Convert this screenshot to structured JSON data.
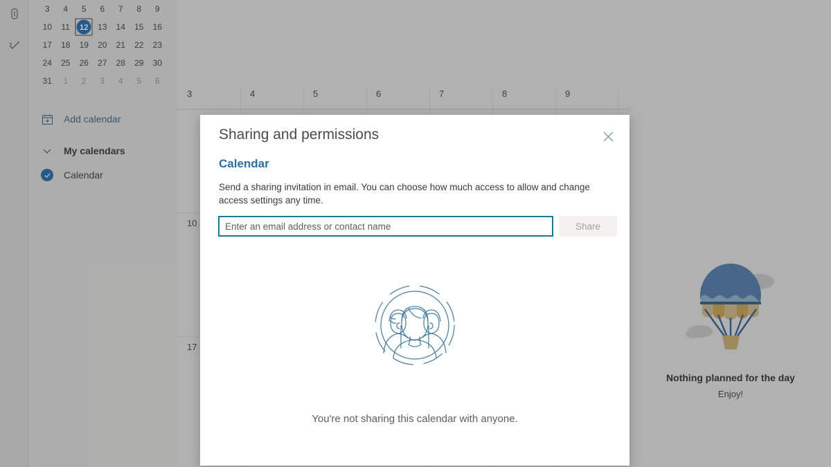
{
  "rail": {
    "items": [
      {
        "name": "calendar-rail-icon",
        "label": "Calendar"
      },
      {
        "name": "tasks-rail-icon",
        "label": "To Do"
      }
    ]
  },
  "sidebar": {
    "mini_calendar": {
      "weeks": [
        [
          {
            "day": "3",
            "state": "normal"
          },
          {
            "day": "4",
            "state": "normal"
          },
          {
            "day": "5",
            "state": "normal"
          },
          {
            "day": "6",
            "state": "normal"
          },
          {
            "day": "7",
            "state": "normal"
          },
          {
            "day": "8",
            "state": "normal"
          },
          {
            "day": "9",
            "state": "normal"
          }
        ],
        [
          {
            "day": "10",
            "state": "normal"
          },
          {
            "day": "11",
            "state": "normal"
          },
          {
            "day": "12",
            "state": "today"
          },
          {
            "day": "13",
            "state": "normal"
          },
          {
            "day": "14",
            "state": "normal"
          },
          {
            "day": "15",
            "state": "normal"
          },
          {
            "day": "16",
            "state": "normal"
          }
        ],
        [
          {
            "day": "17",
            "state": "normal"
          },
          {
            "day": "18",
            "state": "normal"
          },
          {
            "day": "19",
            "state": "normal"
          },
          {
            "day": "20",
            "state": "normal"
          },
          {
            "day": "21",
            "state": "normal"
          },
          {
            "day": "22",
            "state": "normal"
          },
          {
            "day": "23",
            "state": "normal"
          }
        ],
        [
          {
            "day": "24",
            "state": "normal"
          },
          {
            "day": "25",
            "state": "normal"
          },
          {
            "day": "26",
            "state": "normal"
          },
          {
            "day": "27",
            "state": "normal"
          },
          {
            "day": "28",
            "state": "normal"
          },
          {
            "day": "29",
            "state": "normal"
          },
          {
            "day": "30",
            "state": "normal"
          }
        ],
        [
          {
            "day": "31",
            "state": "normal"
          },
          {
            "day": "1",
            "state": "muted"
          },
          {
            "day": "2",
            "state": "muted"
          },
          {
            "day": "3",
            "state": "muted"
          },
          {
            "day": "4",
            "state": "muted"
          },
          {
            "day": "5",
            "state": "muted"
          },
          {
            "day": "6",
            "state": "muted"
          }
        ]
      ],
      "selected_day": "12"
    },
    "add_calendar_label": "Add calendar",
    "my_calendars_label": "My calendars",
    "calendar_item_label": "Calendar"
  },
  "main_calendar": {
    "day_numbers": [
      "3",
      "4",
      "5",
      "6",
      "7",
      "8",
      "9"
    ],
    "week_row_labels": [
      "10",
      "17"
    ]
  },
  "right_panel": {
    "title": "Nothing planned for the day",
    "subtitle": "Enjoy!",
    "illustration": "hot-air-balloon-illustration"
  },
  "dialog": {
    "title": "Sharing and permissions",
    "close_label": "Close",
    "calendar_name": "Calendar",
    "description": "Send a sharing invitation in email. You can choose how much access to allow and change access settings any time.",
    "email_input_value": "",
    "email_input_placeholder": "Enter an email address or contact name",
    "share_button_label": "Share",
    "empty_message": "You're not sharing this calendar with anyone.",
    "illustration": "people-group-illustration"
  },
  "colors": {
    "accent_blue": "#0f6cbd",
    "heading_blue": "#2a6ea5",
    "link_blue": "#31668f",
    "input_focus_border": "#1a7a94",
    "illustration_line": "#4a7f9e",
    "balloon_blue": "#4a7ebb",
    "balloon_tan": "#e0ad4a"
  }
}
